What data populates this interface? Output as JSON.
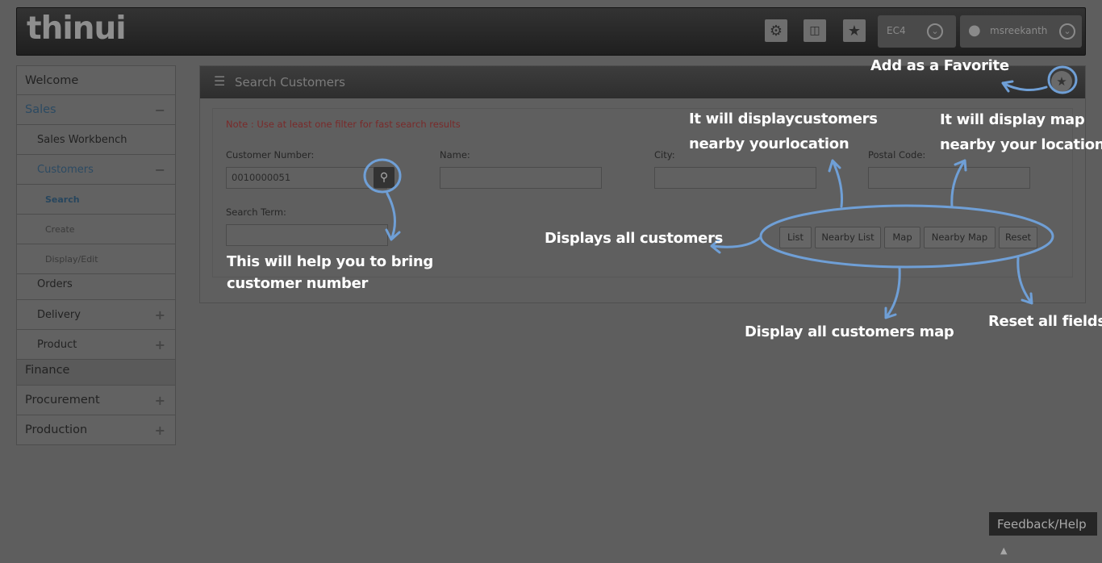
{
  "header": {
    "logo": "thinui",
    "settings_icon": "gear-icon",
    "system_select": "EC4",
    "user_select": "msreekanth"
  },
  "sidebar": {
    "items": [
      {
        "label": "Welcome"
      },
      {
        "label": "Sales",
        "toggle": "−"
      },
      {
        "label": "Sales Workbench"
      },
      {
        "label": "Customers",
        "toggle": "−"
      },
      {
        "label": "Search"
      },
      {
        "label": "Create"
      },
      {
        "label": "Display/Edit"
      },
      {
        "label": "Orders"
      },
      {
        "label": "Delivery",
        "toggle": "+"
      },
      {
        "label": "Product",
        "toggle": "+"
      },
      {
        "label": "Finance"
      },
      {
        "label": "Procurement",
        "toggle": "+"
      },
      {
        "label": "Production",
        "toggle": "+"
      }
    ]
  },
  "panel": {
    "title": "Search Customers",
    "note": "Note : Use at least one filter for fast search results",
    "fields": {
      "customer_number_label": "Customer Number:",
      "customer_number_value": "0010000051",
      "name_label": "Name:",
      "city_label": "City:",
      "postal_code_label": "Postal Code:",
      "search_term_label": "Search Term:"
    },
    "buttons": {
      "list": "List",
      "nearby_list": "Nearby List",
      "map": "Map",
      "nearby_map": "Nearby Map",
      "reset": "Reset"
    }
  },
  "annotations": {
    "favorite": "Add as a Favorite",
    "nearby_list_1": "It will displaycustomers",
    "nearby_list_2": "nearby yourlocation",
    "nearby_map_1": "It will display map",
    "nearby_map_2": "nearby your location",
    "list": "Displays all customers",
    "lookup_1": "This will help you to bring",
    "lookup_2": "customer number",
    "map": "Display all customers map",
    "reset": "Reset all fields"
  },
  "footer": {
    "feedback": "Feedback/Help",
    "feedback_icon": "caret-up-icon"
  }
}
